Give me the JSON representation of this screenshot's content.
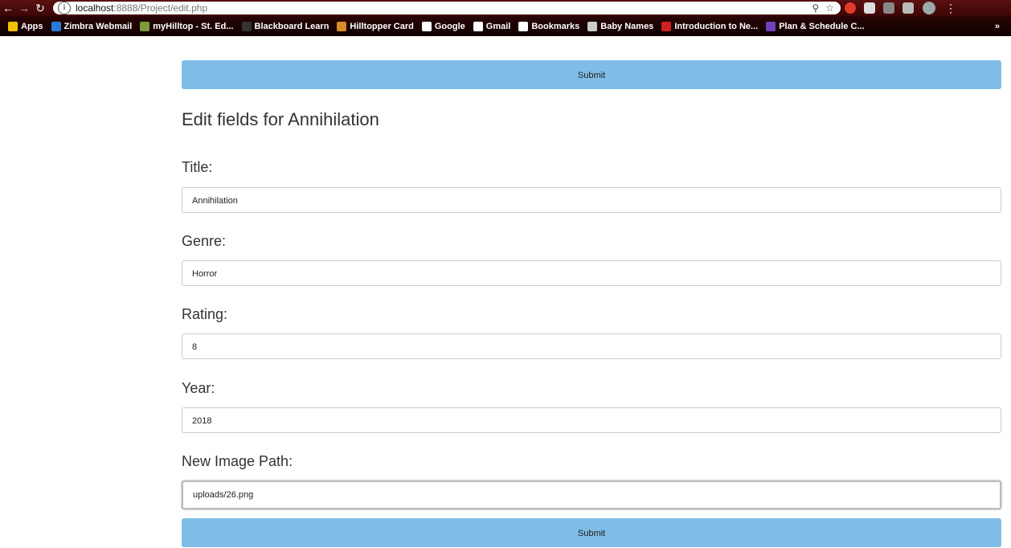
{
  "browser": {
    "url_host": "localhost",
    "url_path": ":8888/Project/edit.php",
    "bookmarks": [
      {
        "label": "Apps",
        "icon": "apps-grid-icon",
        "color": "#f2c200"
      },
      {
        "label": "Zimbra Webmail",
        "icon": "zimbra-icon",
        "color": "#2a7ad8"
      },
      {
        "label": "myHilltop - St. Ed...",
        "icon": "myhilltop-icon",
        "color": "#7c9a3c"
      },
      {
        "label": "Blackboard Learn",
        "icon": "blackboard-icon",
        "color": "#333333"
      },
      {
        "label": "Hilltopper Card",
        "icon": "hilltopper-icon",
        "color": "#d98c2b"
      },
      {
        "label": "Google",
        "icon": "google-icon",
        "color": "#ffffff"
      },
      {
        "label": "Gmail",
        "icon": "google-icon",
        "color": "#ffffff"
      },
      {
        "label": "Bookmarks",
        "icon": "star-icon",
        "color": "#ffffff"
      },
      {
        "label": "Baby Names",
        "icon": "baby-names-icon",
        "color": "#cccccc"
      },
      {
        "label": "Introduction to Ne...",
        "icon": "intro-icon",
        "color": "#cc2222"
      },
      {
        "label": "Plan & Schedule C...",
        "icon": "plan-icon",
        "color": "#7040c0"
      }
    ],
    "more_label": "»"
  },
  "form": {
    "submit_top_label": "Submit",
    "title": "Edit fields for Annihilation",
    "fields": [
      {
        "label": "Title:",
        "value": "Annihilation"
      },
      {
        "label": "Genre:",
        "value": "Horror"
      },
      {
        "label": "Rating:",
        "value": "8"
      },
      {
        "label": "Year:",
        "value": "2018"
      },
      {
        "label": "New Image Path:",
        "value": "uploads/26.png"
      }
    ],
    "submit_bottom_label": "Submit"
  }
}
